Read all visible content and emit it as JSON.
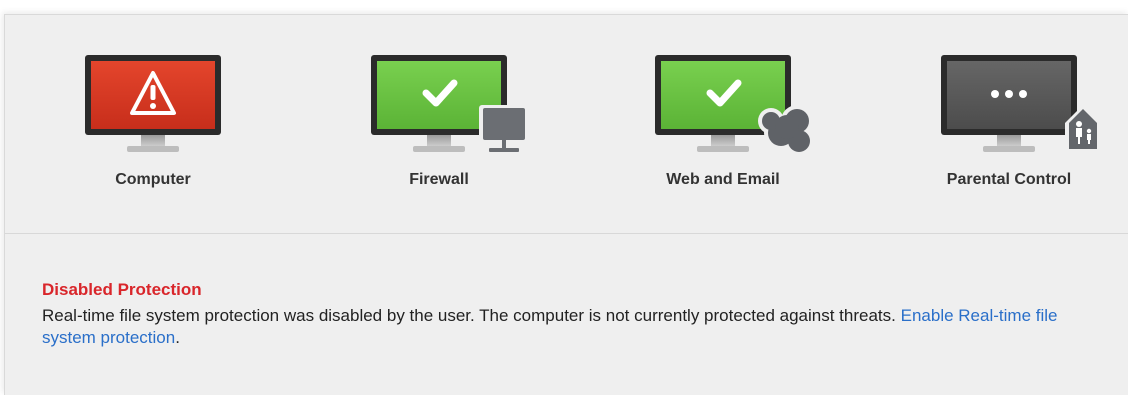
{
  "tiles": [
    {
      "label": "Computer",
      "status": "alert",
      "screen_color": "#d83a24",
      "icon": "warning-icon",
      "badge": null
    },
    {
      "label": "Firewall",
      "status": "ok",
      "screen_color": "#6cc644",
      "icon": "checkmark-icon",
      "badge": "network-monitor-icon"
    },
    {
      "label": "Web and Email",
      "status": "ok",
      "screen_color": "#6cc644",
      "icon": "checkmark-icon",
      "badge": "cloud-icon"
    },
    {
      "label": "Parental Control",
      "status": "inactive",
      "screen_color": "#5a5a5a",
      "icon": "ellipsis-icon",
      "badge": "family-house-icon"
    }
  ],
  "alert": {
    "title": "Disabled Protection",
    "message": "Real-time file system protection was disabled by the user. The computer is not currently protected against threats.",
    "link_text": "Enable Real-time file system protection",
    "trailing": ".",
    "title_color": "#d9262b",
    "link_color": "#2a6fc9"
  }
}
